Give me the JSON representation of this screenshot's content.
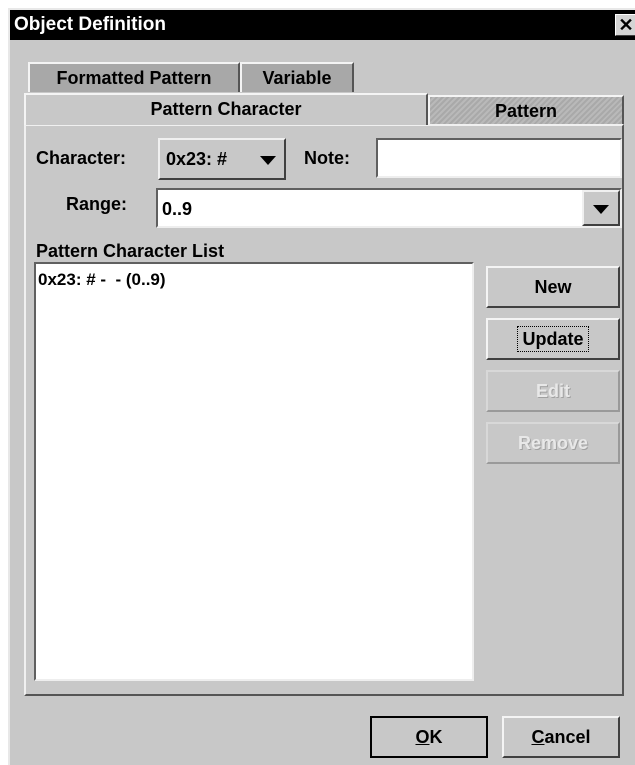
{
  "window": {
    "title": "Object Definition",
    "close_glyph": "✕"
  },
  "tabs": {
    "formatted_pattern": "Formatted Pattern",
    "variable": "Variable",
    "pattern_character": "Pattern Character",
    "pattern": "Pattern"
  },
  "form": {
    "character_label": "Character:",
    "character_value": "0x23: #",
    "note_label": "Note:",
    "note_value": "",
    "range_label": "Range:",
    "range_value": "0..9"
  },
  "list": {
    "header": "Pattern Character List",
    "items": [
      "0x23: # -  - (0..9)"
    ]
  },
  "buttons": {
    "new": "New",
    "update": "Update",
    "edit": "Edit",
    "remove": "Remove",
    "ok_mnemonic": "O",
    "ok_rest": "K",
    "cancel_mnemonic": "C",
    "cancel_rest": "ancel"
  },
  "colors": {
    "titlebar": "#000000",
    "window": "#c8c8c8",
    "disabled_text": "#e8e8e8"
  }
}
